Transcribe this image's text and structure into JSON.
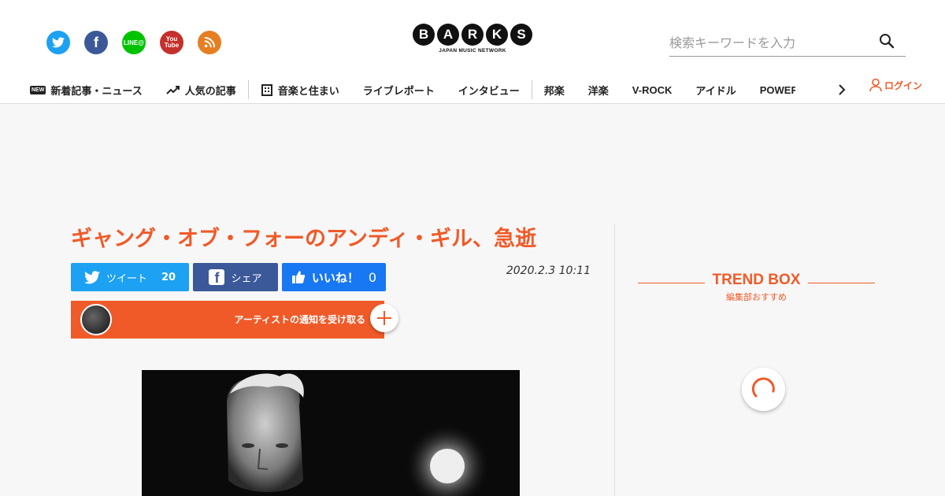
{
  "header": {
    "logo_letters": [
      "B",
      "A",
      "R",
      "K",
      "S"
    ],
    "logo_sub": "JAPAN MUSIC NETWORK",
    "social": {
      "line_label": "LINE@",
      "youtube_top": "You",
      "youtube_bottom": "Tube"
    },
    "search": {
      "placeholder": "検索キーワードを入力",
      "value": ""
    },
    "login_label": "ログイン"
  },
  "nav": {
    "items": [
      {
        "label": "新着記事・ニュース",
        "icon": "new-icon",
        "badge": "NEW"
      },
      {
        "label": "人気の記事",
        "icon": "trending-icon"
      },
      {
        "label": "音楽と住まい",
        "icon": "building-icon"
      },
      {
        "label": "ライブレポート"
      },
      {
        "label": "インタビュー"
      },
      {
        "label": "邦楽"
      },
      {
        "label": "洋楽"
      },
      {
        "label": "V-ROCK"
      },
      {
        "label": "アイドル"
      },
      {
        "label": "POWER PUSH"
      }
    ]
  },
  "article": {
    "title": "ギャング・オブ・フォーのアンディ・ギル、急逝",
    "date": "2020.2.3 10:11",
    "share": {
      "tweet_label": "ツイート",
      "tweet_count": "20",
      "fb_label": "シェア",
      "like_label": "いいね！",
      "like_count": "0"
    },
    "notify_label": "アーティストの通知を受け取る"
  },
  "sidebar": {
    "trend_title": "TREND BOX",
    "trend_sub": "編集部おすすめ"
  },
  "colors": {
    "accent": "#f05a28",
    "twitter": "#1da1f2",
    "facebook": "#3b5998",
    "like": "#1877f2"
  }
}
